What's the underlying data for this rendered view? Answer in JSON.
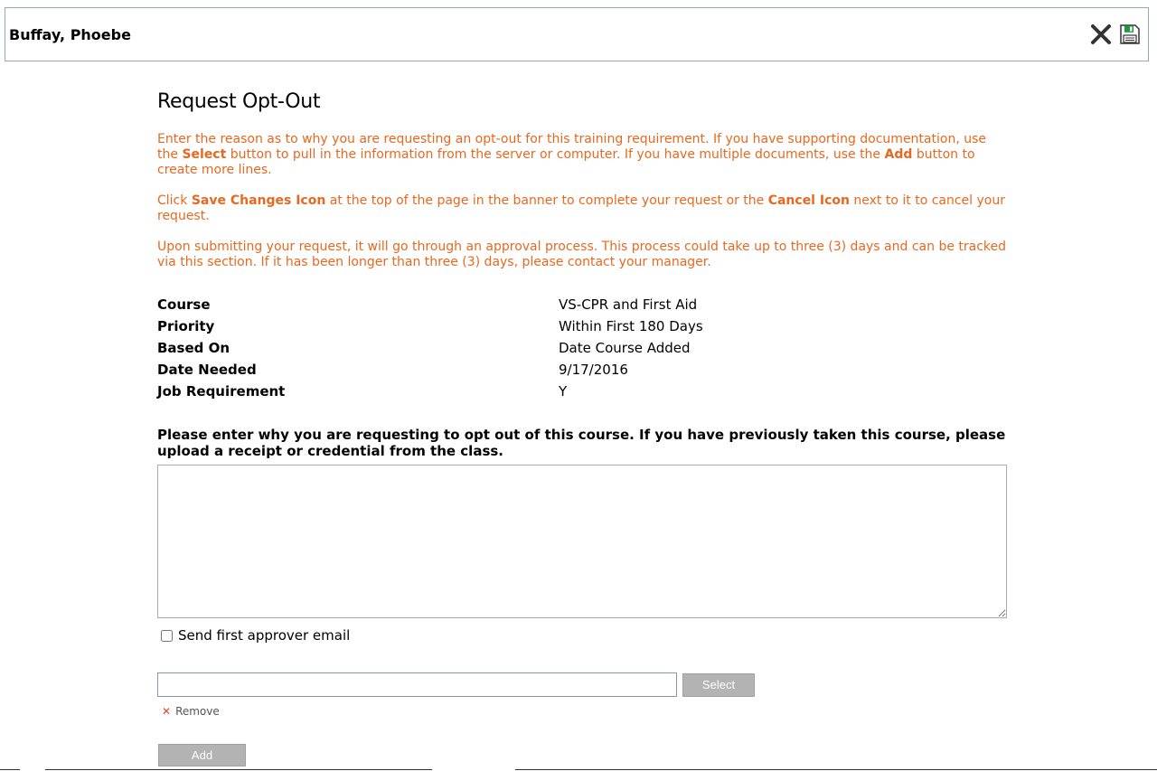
{
  "banner": {
    "name": "Buffay, Phoebe",
    "close_icon": "close-icon",
    "save_icon": "save-icon",
    "save_icon_color": "#1a9e3a"
  },
  "page": {
    "title": "Request Opt-Out",
    "instruction_color": "#e8681f",
    "para1": {
      "t1": "Enter the reason as to why you are requesting an opt-out for this training requirement.  If you have supporting documentation, use the ",
      "b1": "Select",
      "t2": " button to pull in the information from the server or computer.  If you have multiple documents, use the ",
      "b2": "Add",
      "t3": " button to create more lines."
    },
    "para2": {
      "t1": "Click ",
      "b1": "Save Changes Icon",
      "t2": " at the top of the page in the banner to complete your request or the ",
      "b2": "Cancel Icon",
      "t3": " next to it to cancel your request."
    },
    "para3": "Upon submitting your request, it will go through an approval process.  This process could take up to three (3) days and can be tracked via this section.  If it has been longer than three (3) days, please contact your manager."
  },
  "details": [
    {
      "label": "Course",
      "value": "VS-CPR and First Aid"
    },
    {
      "label": "Priority",
      "value": "Within First 180 Days"
    },
    {
      "label": "Based On",
      "value": "Date Course Added"
    },
    {
      "label": "Date Needed",
      "value": "9/17/2016"
    },
    {
      "label": "Job Requirement",
      "value": "Y"
    }
  ],
  "form": {
    "prompt": "Please enter why you are requesting to opt out of this course.  If you have previously taken this course, please upload a receipt or credential from the class.",
    "reason_value": "",
    "send_email_label": "Send first approver email",
    "send_email_checked": false,
    "file_value": "",
    "select_label": "Select",
    "remove_label": "Remove",
    "add_label": "Add"
  }
}
